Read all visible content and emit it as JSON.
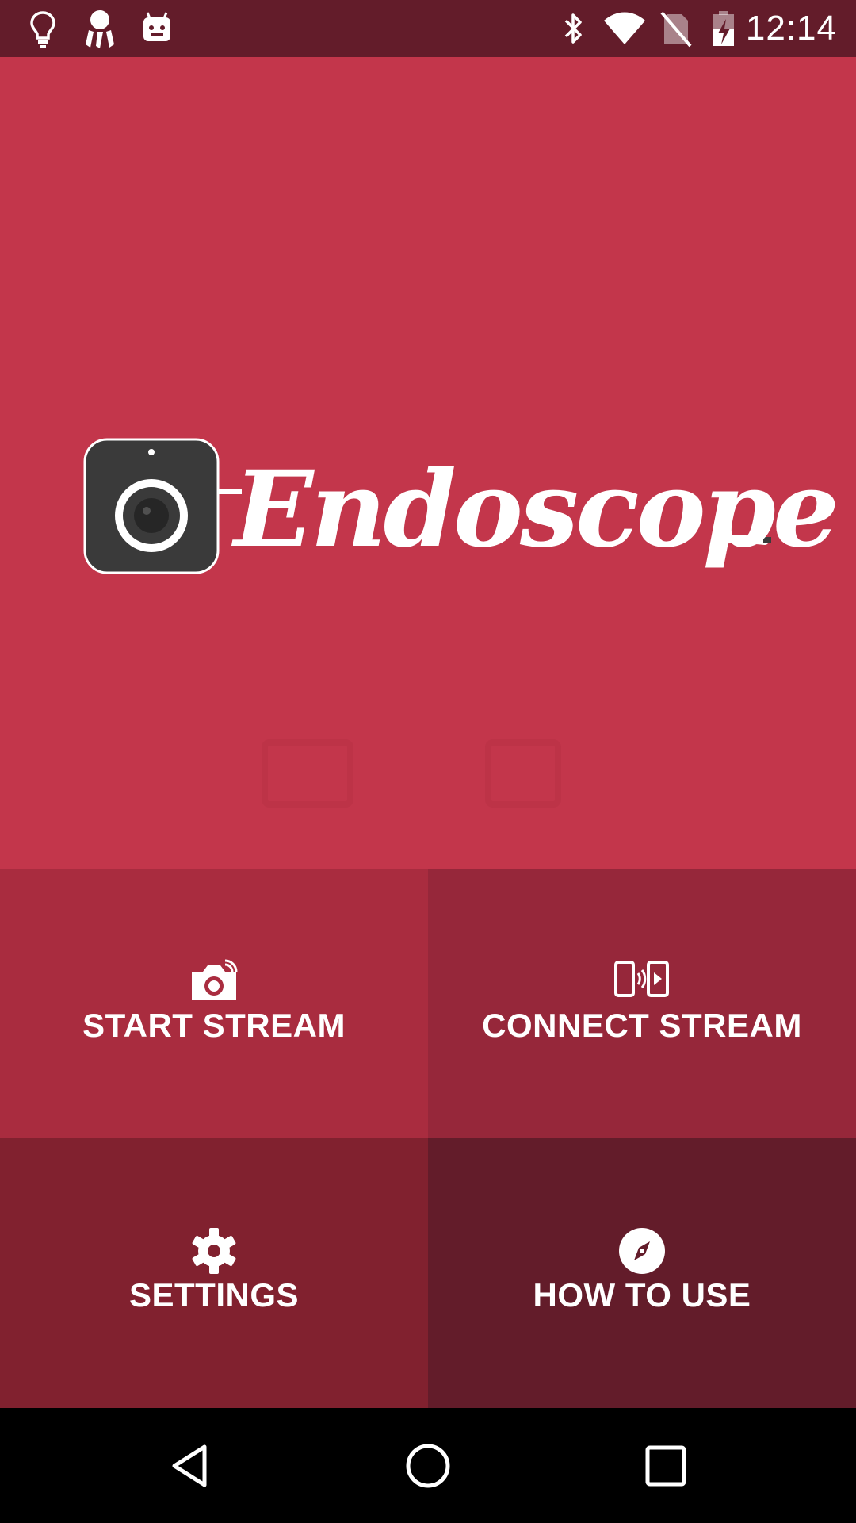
{
  "status_bar": {
    "left_icons": [
      "lightbulb-icon",
      "dreamcatcher-icon",
      "android-robot-icon"
    ],
    "right_icons": [
      "bluetooth-icon",
      "wifi-icon",
      "no-sim-icon",
      "battery-charging-icon"
    ],
    "time": "12:14"
  },
  "hero": {
    "logo_text": "Endoscope",
    "background_color": "#c3364b"
  },
  "tiles": [
    {
      "label": "START STREAM",
      "icon": "camera-stream-icon",
      "color": "#a92c3f"
    },
    {
      "label": "CONNECT STREAM",
      "icon": "phone-connect-icon",
      "color": "#96273a"
    },
    {
      "label": "SETTINGS",
      "icon": "gear-icon",
      "color": "#81212f"
    },
    {
      "label": "HOW TO USE",
      "icon": "compass-icon",
      "color": "#631c2a"
    }
  ],
  "nav_bar": {
    "buttons": [
      "back-icon",
      "home-icon",
      "recents-icon"
    ]
  },
  "colors": {
    "status_bar": "#631c2a",
    "accent": "#c3364b"
  }
}
